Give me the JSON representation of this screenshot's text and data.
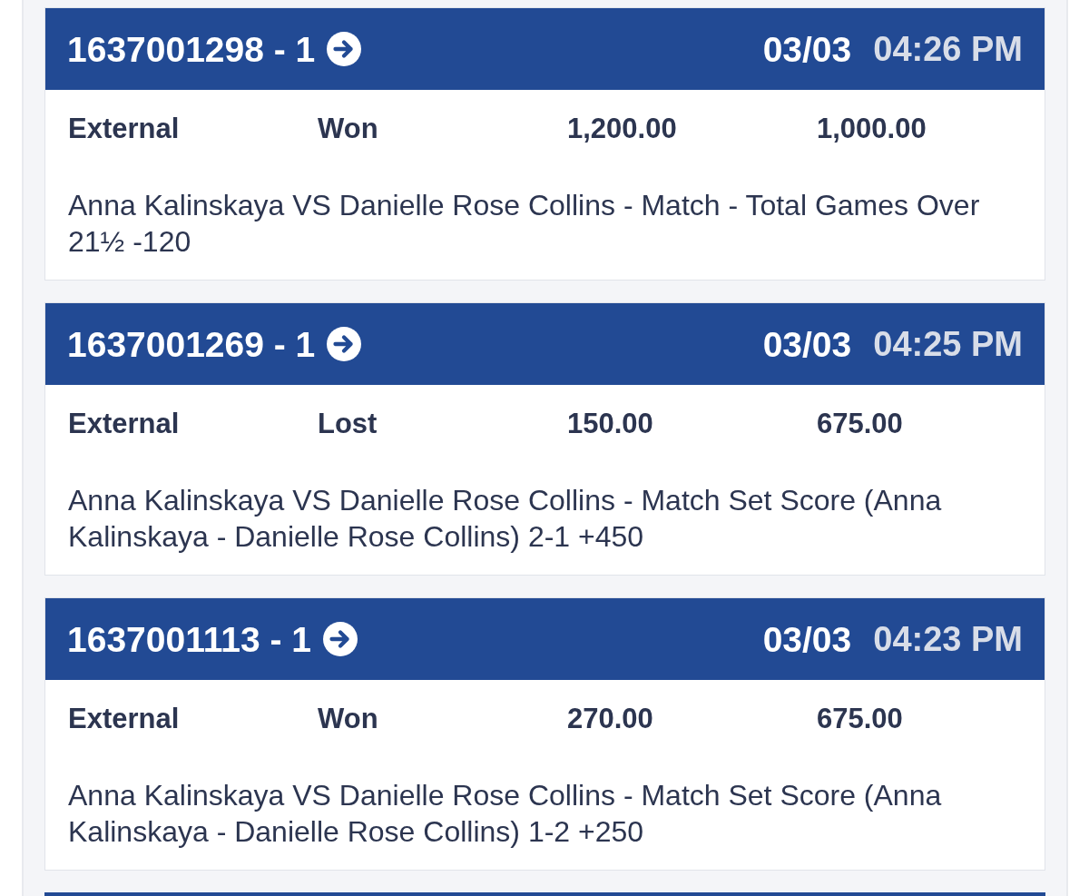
{
  "bets": [
    {
      "ticket": "1637001298 - 1",
      "date": "03/03",
      "time": "04:26 PM",
      "cells": [
        "External",
        "Won",
        "1,200.00",
        "1,000.00"
      ],
      "description": "Anna Kalinskaya VS Danielle Rose Collins - Match - Total Games Over 21½ -120"
    },
    {
      "ticket": "1637001269 - 1",
      "date": "03/03",
      "time": "04:25 PM",
      "cells": [
        "External",
        "Lost",
        "150.00",
        "675.00"
      ],
      "description": "Anna Kalinskaya VS Danielle Rose Collins - Match Set Score (Anna Kalinskaya - Danielle Rose Collins) 2-1 +450"
    },
    {
      "ticket": "1637001113 - 1",
      "date": "03/03",
      "time": "04:23 PM",
      "cells": [
        "External",
        "Won",
        "270.00",
        "675.00"
      ],
      "description": "Anna Kalinskaya VS Danielle Rose Collins - Match Set Score (Anna Kalinskaya - Danielle Rose Collins) 1-2 +250"
    }
  ]
}
